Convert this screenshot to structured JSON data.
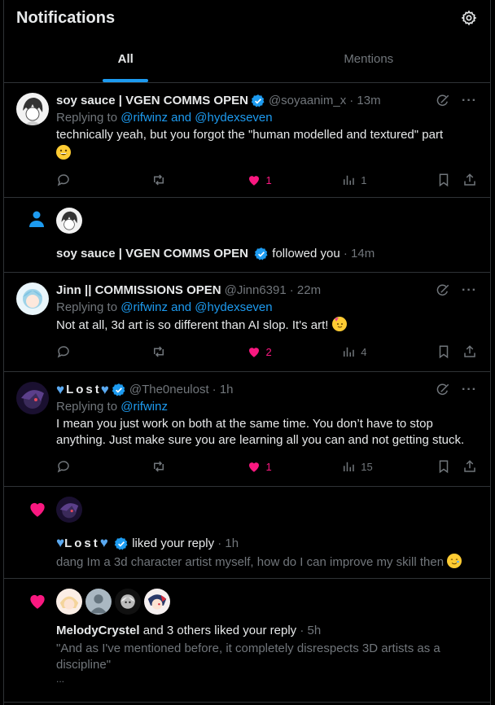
{
  "header": {
    "title": "Notifications",
    "settings_icon": "gear-icon"
  },
  "tabs": [
    {
      "label": "All",
      "active": true
    },
    {
      "label": "Mentions",
      "active": false
    }
  ],
  "tweets": [
    {
      "name": "soy sauce | VGEN COMMS OPEN",
      "handle": "@soyaanim_x",
      "time": "· 13m",
      "replying_prefix": "Replying to ",
      "replying_to": "@rifwinz and @hydexseven",
      "text": "technically yeah, but you forgot the \"human modelled and textured\" part",
      "replies": "",
      "retweets": "",
      "likes": "1",
      "views": "1"
    },
    {
      "name": "Jinn || COMMISSIONS OPEN",
      "handle": "@Jinn6391",
      "time": "· 22m",
      "replying_prefix": "Replying to ",
      "replying_to": "@rifwinz and @hydexseven",
      "text": "Not at all, 3d art is so different than AI slop. It's art!",
      "replies": "",
      "retweets": "",
      "likes": "2",
      "views": "4"
    },
    {
      "name": "Lost",
      "handle": "@The0neulost",
      "time": "· 1h",
      "replying_prefix": "Replying to ",
      "replying_to": "@rifwinz",
      "text": "I mean you just work on both at the same time. You don’t have to stop anything. Just make sure you are learning all you can and not getting stuck.",
      "replies": "",
      "retweets": "",
      "likes": "1",
      "views": "15"
    }
  ],
  "follow_notif": {
    "name": "soy sauce | VGEN COMMS OPEN",
    "action": "followed you",
    "time": "· 14m"
  },
  "like_notif_1": {
    "name": "Lost",
    "action": "liked your reply",
    "time": "· 1h",
    "quote": "dang Im a 3d character artist myself, how do I can improve my skill then"
  },
  "like_notif_2": {
    "name": "MelodyCrystel",
    "action": "and 3 others liked your reply",
    "time": "· 5h",
    "quote": "\"And as I've mentioned before, it completely disrespects 3D artists as a discipline\"",
    "ellipsis": "..."
  },
  "colors": {
    "accent": "#1d9bf0",
    "like": "#f91880",
    "muted": "#71767b",
    "text": "#e7e9ea",
    "border": "#2f3336"
  }
}
